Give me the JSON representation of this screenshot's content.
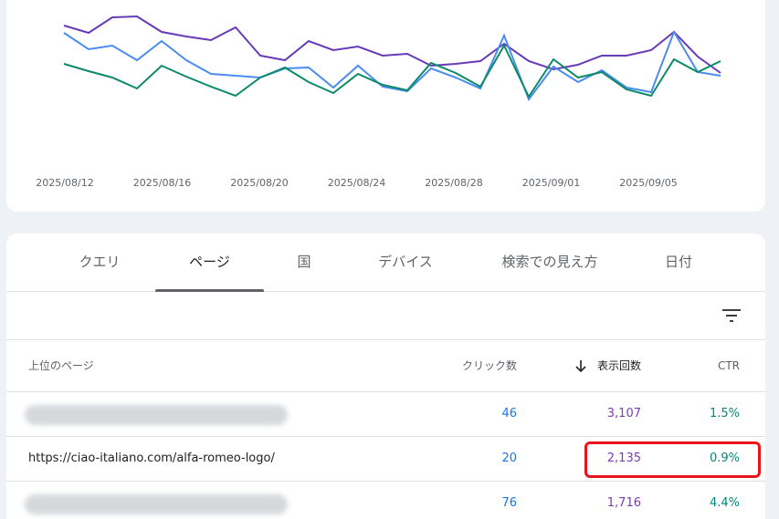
{
  "chart": {
    "x_ticks": [
      "2025/08/12",
      "2025/08/16",
      "2025/08/20",
      "2025/08/24",
      "2025/08/28",
      "2025/09/01",
      "2025/09/05"
    ],
    "series_colors": {
      "purple": "#673ab7",
      "blue": "#4285f4",
      "green": "#0b8a6a"
    }
  },
  "tabs": [
    {
      "label": "クエリ",
      "selected": false
    },
    {
      "label": "ページ",
      "selected": true
    },
    {
      "label": "国",
      "selected": false
    },
    {
      "label": "デバイス",
      "selected": false
    },
    {
      "label": "検索での見え方",
      "selected": false
    },
    {
      "label": "日付",
      "selected": false
    }
  ],
  "table": {
    "headers": {
      "page": "上位のページ",
      "clicks": "クリック数",
      "impressions": "表示回数",
      "ctr": "CTR"
    },
    "sort_icon": "arrow-down-icon",
    "rows": [
      {
        "page": "",
        "blurred": true,
        "clicks": "46",
        "impressions": "3,107",
        "ctr": "1.5%"
      },
      {
        "page": "https://ciao-italiano.com/alfa-romeo-logo/",
        "blurred": false,
        "clicks": "20",
        "impressions": "2,135",
        "ctr": "0.9%"
      },
      {
        "page": "",
        "blurred": true,
        "clicks": "76",
        "impressions": "1,716",
        "ctr": "4.4%"
      }
    ]
  },
  "colors": {
    "highlight": "#e8141c",
    "clicks": "#1a73e8",
    "impressions": "#7e3ab5",
    "ctr": "#00897b"
  }
}
